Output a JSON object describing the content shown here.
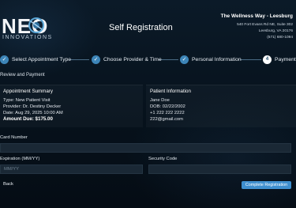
{
  "brand": {
    "logo_main": "NEO",
    "logo_sub": "INNOVATIONS"
  },
  "header": {
    "title": "Self Registration",
    "clinic_name": "The Wellness Way - Leesburg",
    "address_line1": "540 Fort Evans Rd NE, Suite 302",
    "address_line2": "Leesburg, VA 20176",
    "phone": "(571) 680-1094"
  },
  "steps": [
    {
      "label": "Select Appointment Type",
      "state": "done",
      "marker": "✓"
    },
    {
      "label": "Choose Provider & Time",
      "state": "done",
      "marker": "✓"
    },
    {
      "label": "Personal Information",
      "state": "done",
      "marker": "✓"
    },
    {
      "label": "Payment",
      "state": "active",
      "marker": "4"
    }
  ],
  "section_title": "Review and Payment",
  "appointment": {
    "title": "Appointment Summary",
    "type": "Type: New Patient Visit",
    "provider": "Provider: Dr. Destiny Decker",
    "date": "Date: Aug 29, 2025 10:00 AM",
    "amount": "Amount Due: $175.00"
  },
  "patient": {
    "title": "Patient Information",
    "name": "Jane Doe",
    "dob": "DOB: 02/22/2002",
    "phone": "+1 222 222 2222",
    "email": "222@gmail.com"
  },
  "form": {
    "card_label": "Card Number",
    "card_value": "",
    "expiration_label": "Expiration (MM/YY)",
    "expiration_placeholder": "MM/YY",
    "security_label": "Security Code",
    "security_value": ""
  },
  "actions": {
    "back": "Back",
    "complete": "Complete Registration"
  },
  "colors": {
    "accent": "#3f8fcf",
    "step_done": "#3d85b8",
    "background": "#07101a"
  }
}
